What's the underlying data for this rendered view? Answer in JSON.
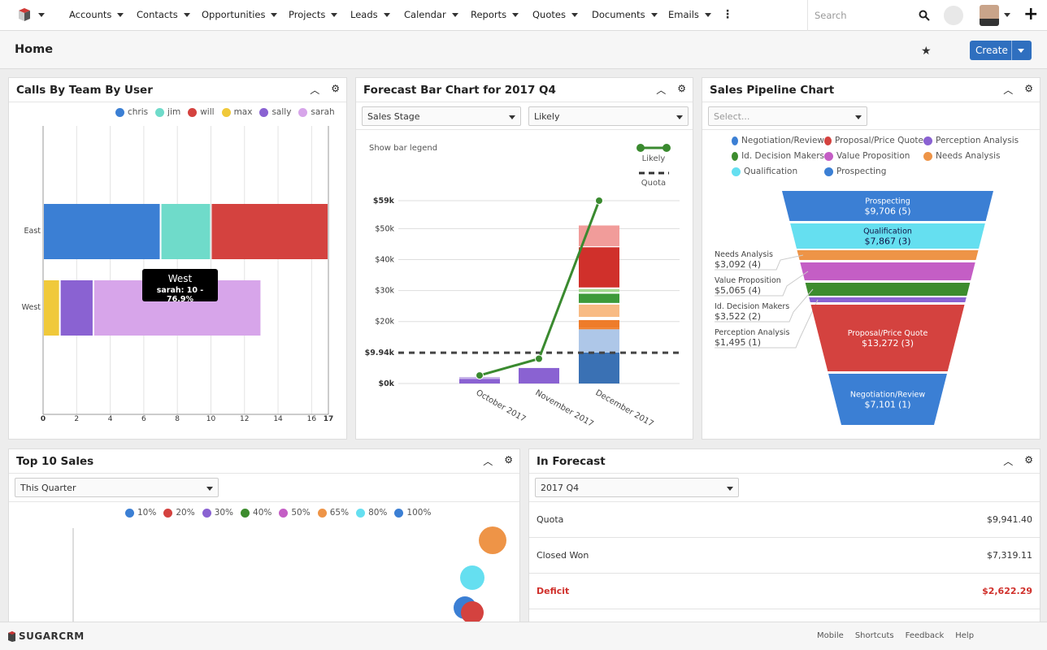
{
  "nav": {
    "items": [
      "Accounts",
      "Contacts",
      "Opportunities",
      "Projects",
      "Leads",
      "Calendar",
      "Reports",
      "Quotes",
      "Documents",
      "Emails"
    ],
    "search_placeholder": "Search"
  },
  "header": {
    "title": "Home",
    "create_label": "Create"
  },
  "calls": {
    "title": "Calls By Team By User",
    "tooltip_title": "West",
    "tooltip_text": "sarah: 10 - 76.9%"
  },
  "forecast": {
    "title": "Forecast Bar Chart for 2017 Q4",
    "select1": "Sales Stage",
    "select2": "Likely",
    "show_legend": "Show bar legend"
  },
  "pipeline": {
    "title": "Sales Pipeline Chart",
    "select_placeholder": "Select..."
  },
  "top10": {
    "title": "Top 10 Sales",
    "select": "This Quarter"
  },
  "inforecast": {
    "title": "In Forecast",
    "select": "2017 Q4",
    "rows": [
      {
        "label": "Quota",
        "value": "$9,941.40"
      },
      {
        "label": "Closed Won",
        "value": "$7,319.11"
      },
      {
        "label": "Deficit",
        "value": "$2,622.29",
        "color": "#d0302b"
      }
    ]
  },
  "footer": {
    "brand": "SUGARCRM",
    "links": [
      "Mobile",
      "Shortcuts",
      "Feedback",
      "Help"
    ]
  },
  "colors": {
    "accent": "#2f6fbf"
  },
  "chart_data": [
    {
      "type": "bar",
      "orientation": "horizontal",
      "stacked": true,
      "categories": [
        "East",
        "West"
      ],
      "series": [
        {
          "name": "chris",
          "color": "#3b7fd4",
          "values": [
            7,
            0
          ]
        },
        {
          "name": "jim",
          "color": "#6fdbca",
          "values": [
            3,
            0
          ]
        },
        {
          "name": "will",
          "color": "#d4423f",
          "values": [
            7,
            0
          ]
        },
        {
          "name": "max",
          "color": "#f0c93a",
          "values": [
            0,
            1
          ]
        },
        {
          "name": "sally",
          "color": "#8a62d2",
          "values": [
            0,
            2
          ]
        },
        {
          "name": "sarah",
          "color": "#d7a5ea",
          "values": [
            0,
            10
          ]
        }
      ],
      "xticks": [
        0,
        2,
        4,
        6,
        8,
        10,
        12,
        14,
        16,
        17
      ],
      "xlim": [
        0,
        17
      ],
      "grid": true,
      "legend": "top-right"
    },
    {
      "type": "bar",
      "stacked": true,
      "categories": [
        "October 2017",
        "November 2017",
        "December 2017"
      ],
      "yticks": [
        "$0k",
        "$9.94k",
        "$20k",
        "$30k",
        "$40k",
        "$50k",
        "$59k"
      ],
      "ylim": [
        0,
        59
      ],
      "stacks": [
        [
          {
            "color": "#8a62d2",
            "value": 1.5
          },
          {
            "color": "#c9b6ea",
            "value": 0.6
          }
        ],
        [
          {
            "color": "#8a62d2",
            "value": 5
          }
        ],
        [
          {
            "color": "#3a71b4",
            "value": 10
          },
          {
            "color": "#aec7e8",
            "value": 7.5
          },
          {
            "color": "#f07f2a",
            "value": 0.5
          },
          {
            "color": "#ee7c2a",
            "value": 2.5
          },
          {
            "color": "#fff",
            "value": 1
          },
          {
            "color": "#f8bb84",
            "value": 4
          },
          {
            "color": "#fff",
            "value": 0.5
          },
          {
            "color": "#3d9a3a",
            "value": 3
          },
          {
            "color": "#fff",
            "value": 0.5
          },
          {
            "color": "#a3d990",
            "value": 1
          },
          {
            "color": "#fff",
            "value": 0.5
          },
          {
            "color": "#d0302b",
            "value": 13
          },
          {
            "color": "#fff",
            "value": 0.3
          },
          {
            "color": "#f19c9a",
            "value": 6.7
          }
        ]
      ],
      "lines": [
        {
          "name": "Likely",
          "color": "#3a8a2f",
          "values": [
            2.6,
            8,
            59
          ]
        }
      ],
      "reference": {
        "name": "Quota",
        "value": 9.94
      },
      "legend": "top-right"
    },
    {
      "type": "funnel",
      "legend": "top",
      "stages": [
        {
          "name": "Prospecting",
          "value": "$9,706",
          "count": "(5)",
          "color": "#3b7fd4"
        },
        {
          "name": "Qualification",
          "value": "$7,867",
          "count": "(3)",
          "color": "#65dff0"
        },
        {
          "name": "Needs Analysis",
          "value": "$3,092",
          "count": "(4)",
          "color": "#ee9447"
        },
        {
          "name": "Value Proposition",
          "value": "$5,065",
          "count": "(4)",
          "color": "#c45ec5"
        },
        {
          "name": "Id. Decision Makers",
          "value": "$3,522",
          "count": "(2)",
          "color": "#3d8c2e"
        },
        {
          "name": "Perception Analysis",
          "value": "$1,495",
          "count": "(1)",
          "color": "#8a62d2"
        },
        {
          "name": "Proposal/Price Quote",
          "value": "$13,272",
          "count": "(3)",
          "color": "#d4423f"
        },
        {
          "name": "Negotiation/Review",
          "value": "$7,101",
          "count": "(1)",
          "color": "#3b7fd4"
        }
      ],
      "legend_order": [
        "Negotiation/Review",
        "Proposal/Price Quote",
        "Perception Analysis",
        "Id. Decision Makers",
        "Value Proposition",
        "Needs Analysis",
        "Qualification",
        "Prospecting"
      ]
    },
    {
      "type": "scatter",
      "legend": "top",
      "series": [
        {
          "name": "10%",
          "color": "#3b7fd4"
        },
        {
          "name": "20%",
          "color": "#d4423f"
        },
        {
          "name": "30%",
          "color": "#8a62d2"
        },
        {
          "name": "40%",
          "color": "#3d8c2e"
        },
        {
          "name": "50%",
          "color": "#c45ec5"
        },
        {
          "name": "65%",
          "color": "#ee9447"
        },
        {
          "name": "80%",
          "color": "#65dff0"
        },
        {
          "name": "100%",
          "color": "#3b7fd4"
        }
      ],
      "points": [
        {
          "series": "65%"
        },
        {
          "series": "80%"
        },
        {
          "series": "10%"
        },
        {
          "series": "20%"
        }
      ]
    }
  ]
}
